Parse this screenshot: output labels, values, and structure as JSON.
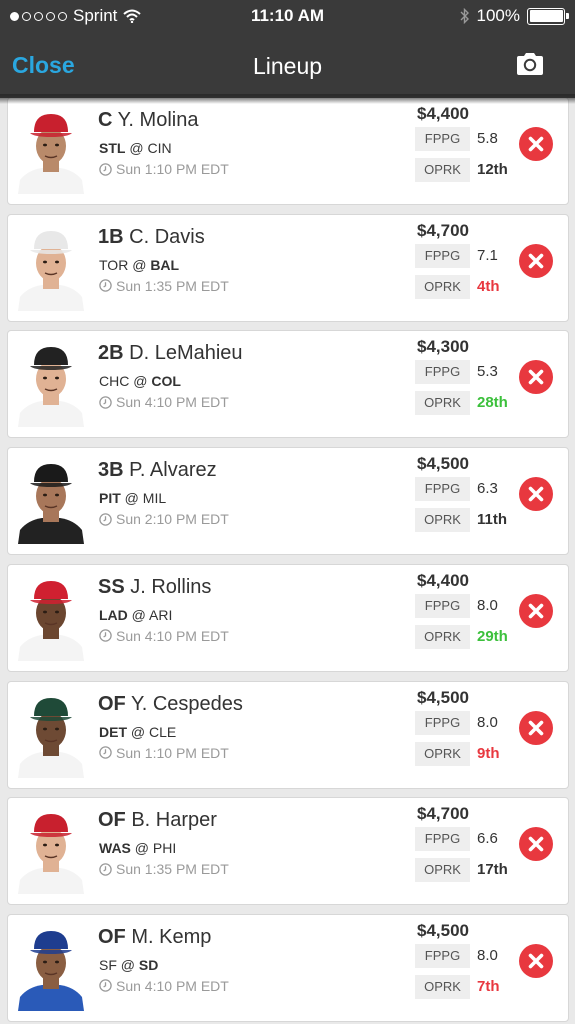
{
  "status_bar": {
    "carrier": "Sprint",
    "time": "11:10 AM",
    "battery": "100%"
  },
  "nav": {
    "close_label": "Close",
    "title": "Lineup",
    "camera_icon": "camera-icon"
  },
  "colors": {
    "accent": "#2aa7e0",
    "remove": "#e8383f",
    "rank_bad": "#e8383f",
    "rank_good": "#3cc03c",
    "rank_neutral": "#333333"
  },
  "players": [
    {
      "pos": "C",
      "name": "Y. Molina",
      "team": "STL",
      "opp": "CIN",
      "bold": "away",
      "time": "Sun 1:10 PM EDT",
      "salary": "$4,400",
      "fppg_label": "FPPG",
      "fppg": "5.8",
      "oprk_label": "OPRK",
      "oprk": "12th",
      "rank_color": "neutral",
      "cap": "#c8202e",
      "jersey": "#f4f4f4",
      "skin": "#b98a6a"
    },
    {
      "pos": "1B",
      "name": "C. Davis",
      "team": "TOR",
      "opp": "BAL",
      "bold": "home",
      "time": "Sun 1:35 PM EDT",
      "salary": "$4,700",
      "fppg_label": "FPPG",
      "fppg": "7.1",
      "oprk_label": "OPRK",
      "oprk": "4th",
      "rank_color": "bad",
      "cap": "#e8e8e8",
      "jersey": "#f4f4f4",
      "skin": "#e0b294"
    },
    {
      "pos": "2B",
      "name": "D. LeMahieu",
      "team": "CHC",
      "opp": "COL",
      "bold": "home",
      "time": "Sun 4:10 PM EDT",
      "salary": "$4,300",
      "fppg_label": "FPPG",
      "fppg": "5.3",
      "oprk_label": "OPRK",
      "oprk": "28th",
      "rank_color": "good",
      "cap": "#222222",
      "jersey": "#f4f4f4",
      "skin": "#e0b294"
    },
    {
      "pos": "3B",
      "name": "P. Alvarez",
      "team": "PIT",
      "opp": "MIL",
      "bold": "away",
      "time": "Sun 2:10 PM EDT",
      "salary": "$4,500",
      "fppg_label": "FPPG",
      "fppg": "6.3",
      "oprk_label": "OPRK",
      "oprk": "11th",
      "rank_color": "neutral",
      "cap": "#1a1a1a",
      "jersey": "#222222",
      "skin": "#a8775a"
    },
    {
      "pos": "SS",
      "name": "J. Rollins",
      "team": "LAD",
      "opp": "ARI",
      "bold": "away",
      "time": "Sun 4:10 PM EDT",
      "salary": "$4,400",
      "fppg_label": "FPPG",
      "fppg": "8.0",
      "oprk_label": "OPRK",
      "oprk": "29th",
      "rank_color": "good",
      "cap": "#d02030",
      "jersey": "#f4f4f4",
      "skin": "#6b4630"
    },
    {
      "pos": "OF",
      "name": "Y. Cespedes",
      "team": "DET",
      "opp": "CLE",
      "bold": "away",
      "time": "Sun 1:10 PM EDT",
      "salary": "$4,500",
      "fppg_label": "FPPG",
      "fppg": "8.0",
      "oprk_label": "OPRK",
      "oprk": "9th",
      "rank_color": "bad",
      "cap": "#1f4a38",
      "jersey": "#f4f4f4",
      "skin": "#6e4a34"
    },
    {
      "pos": "OF",
      "name": "B. Harper",
      "team": "WAS",
      "opp": "PHI",
      "bold": "away",
      "time": "Sun 1:35 PM EDT",
      "salary": "$4,700",
      "fppg_label": "FPPG",
      "fppg": "6.6",
      "oprk_label": "OPRK",
      "oprk": "17th",
      "rank_color": "neutral",
      "cap": "#c8202e",
      "jersey": "#f4f4f4",
      "skin": "#e0b294"
    },
    {
      "pos": "OF",
      "name": "M. Kemp",
      "team": "SF",
      "opp": "SD",
      "bold": "home",
      "time": "Sun 4:10 PM EDT",
      "salary": "$4,500",
      "fppg_label": "FPPG",
      "fppg": "8.0",
      "oprk_label": "OPRK",
      "oprk": "7th",
      "rank_color": "bad",
      "cap": "#1e3d8f",
      "jersey": "#2a5ab8",
      "skin": "#8a5e42"
    }
  ]
}
